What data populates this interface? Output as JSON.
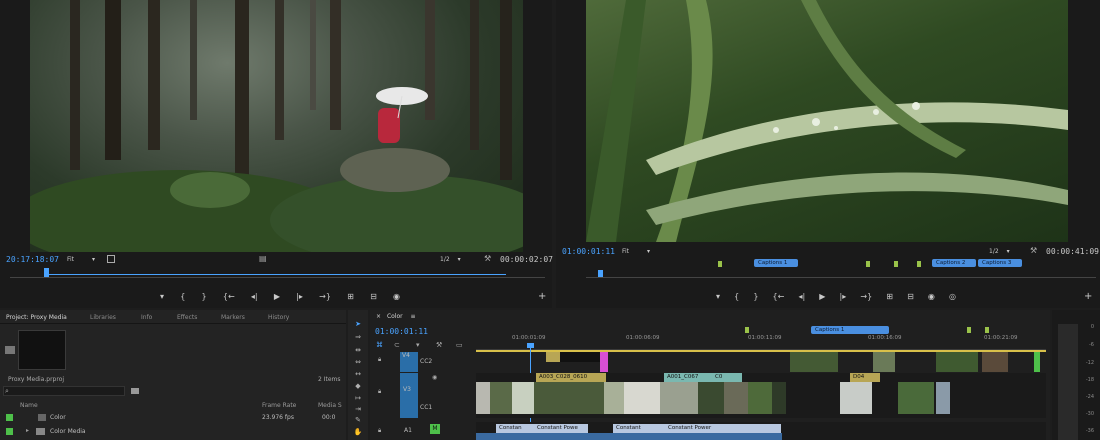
{
  "source_monitor": {
    "timecode_left": "20:17:18:07",
    "fit_label": "Fit",
    "resolution": "1/2",
    "timecode_right": "00:00:02:07"
  },
  "program_monitor": {
    "timecode_left": "01:00:01:11",
    "fit_label": "Fit",
    "resolution": "1/2",
    "timecode_right": "00:00:41:09",
    "captions": [
      "Captions 1",
      "Captions 2",
      "Captions 3"
    ]
  },
  "transport_glyphs": {
    "marker": "▾",
    "in": "{",
    "out": "}",
    "go_in": "{←",
    "step_back": "◂|",
    "play": "▶",
    "step_fwd": "|▸",
    "go_out": "→}",
    "insert": "⊞",
    "overwrite": "⊟",
    "export": "◉",
    "compare": "◎",
    "add": "+"
  },
  "project_panel": {
    "tabs": [
      "Project: Proxy Media",
      "Libraries",
      "Info",
      "Effects",
      "Markers",
      "History"
    ],
    "filename": "Proxy Media.prproj",
    "item_count": "2 Items",
    "columns": {
      "name": "Name",
      "frame_rate": "Frame Rate",
      "media_start": "Media S"
    },
    "rows": [
      {
        "name": "Color",
        "frame_rate": "23.976 fps",
        "media_start": "00:0"
      },
      {
        "name": "Color Media",
        "frame_rate": "",
        "media_start": ""
      }
    ]
  },
  "timeline": {
    "tab_close": "×",
    "tab_label": "Color",
    "tab_menu": "≡",
    "timecode": "01:00:01:11",
    "ruler": [
      "01:00:01:09",
      "01:00:06:09",
      "01:00:11:09",
      "01:00:16:09",
      "01:00:21:09"
    ],
    "caption_chip": "Captions 1",
    "tracks": [
      "V4",
      "CC2",
      "V3",
      "CC1",
      "A1"
    ],
    "clips_v3": [
      "A003_C028_0610",
      "A001_C067",
      "C0",
      "D04"
    ],
    "clips_a1": [
      "Constan",
      "Constant Powe",
      "Constant",
      "Constant Power"
    ]
  },
  "meter": {
    "labels": [
      "0",
      "-6",
      "-12",
      "-18",
      "-24",
      "-30",
      "-36"
    ]
  },
  "colors": {
    "accent_blue": "#4aa3ff",
    "clip_teal": "#7ab8b0",
    "clip_yellow": "#b8a655",
    "caption_blue": "#4a8fe0",
    "marker_green": "#9ac34a"
  }
}
